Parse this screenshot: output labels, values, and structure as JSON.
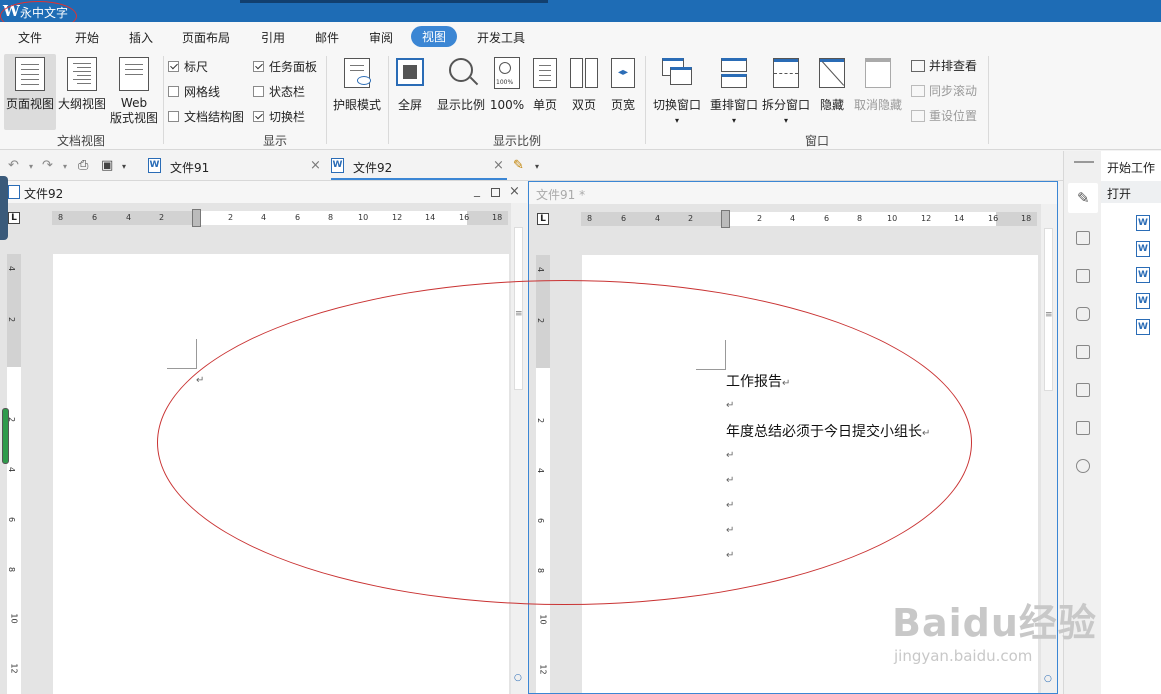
{
  "app": {
    "title": "永中文字"
  },
  "menu": {
    "items": [
      "文件",
      "开始",
      "插入",
      "页面布局",
      "引用",
      "邮件",
      "审阅",
      "视图",
      "开发工具"
    ],
    "active": "视图"
  },
  "ribbon": {
    "doc_view": {
      "page_view": "页面视图",
      "outline_view": "大纲视图",
      "web_view_1": "Web",
      "web_view_2": "版式视图",
      "group": "文档视图"
    },
    "show": {
      "ruler": "标尺",
      "gridlines": "网格线",
      "doc_map": "文档结构图",
      "task_pane": "任务面板",
      "status_bar": "状态栏",
      "switch_bar": "切换栏",
      "group": "显示"
    },
    "eye_mode": "护眼模式",
    "zoom": {
      "fullscreen": "全屏",
      "zoom_ratio": "显示比例",
      "hundred": "100%",
      "single_page": "单页",
      "double_page": "双页",
      "page_width": "页宽",
      "group": "显示比例",
      "hundred_icon_text": "100%"
    },
    "window": {
      "switch_window": "切换窗口",
      "rearrange": "重排窗口",
      "split": "拆分窗口",
      "hide": "隐藏",
      "unhide": "取消隐藏",
      "group": "窗口",
      "side_by_side": "并排查看",
      "sync_scroll": "同步滚动",
      "reset_position": "重设位置"
    }
  },
  "tabs": [
    {
      "name": "文件91"
    },
    {
      "name": "文件92"
    }
  ],
  "pane_left": {
    "title": "文件92"
  },
  "pane_right": {
    "title": "文件91 *"
  },
  "ruler": {
    "labels": [
      "8",
      "6",
      "4",
      "2",
      "2",
      "4",
      "6",
      "8",
      "10",
      "12",
      "14",
      "16",
      "18"
    ],
    "vlabels": [
      "4",
      "2",
      "2",
      "4",
      "6",
      "8",
      "10",
      "12"
    ],
    "corner": "L"
  },
  "document": {
    "lines": [
      "工作报告",
      "",
      "年度总结必须于今日提交小组长",
      "",
      "",
      "",
      ""
    ],
    "para_mark": "↵"
  },
  "sidebar": {
    "title": "开始工作",
    "open": "打开"
  },
  "watermark": {
    "line1": "Baidu经验",
    "line2": "jingyan.baidu.com"
  },
  "colors": {
    "title_bar": "#1e6cb5",
    "accent": "#3b86d4",
    "annotation": "#c93333"
  }
}
